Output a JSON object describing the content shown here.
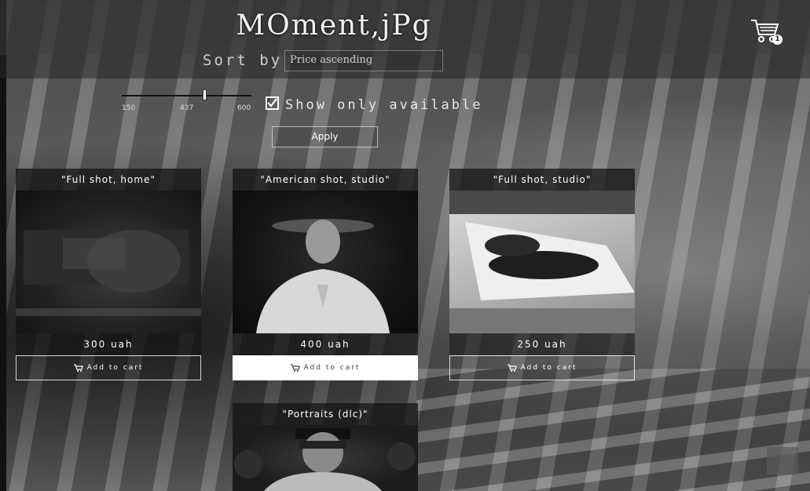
{
  "header": {
    "logo": "MOment,jPg",
    "cart_count": "1"
  },
  "filters": {
    "sort_label": "Sort by",
    "sort_value": "Price ascending",
    "price_min": "150",
    "price_current": "437",
    "price_max": "600",
    "show_only_available_label": "Show only available",
    "show_only_available_checked": true,
    "apply_label": "Apply"
  },
  "products": [
    {
      "title": "\"Full shot, home\"",
      "price": "300 uah",
      "button": "Add to cart"
    },
    {
      "title": "\"American shot, studio\"",
      "price": "400 uah",
      "button": "Add to cart"
    },
    {
      "title": "\"Full shot, studio\"",
      "price": "250 uah",
      "button": "Add to cart"
    },
    {
      "title": "\"Portraits (dlc)\""
    }
  ]
}
